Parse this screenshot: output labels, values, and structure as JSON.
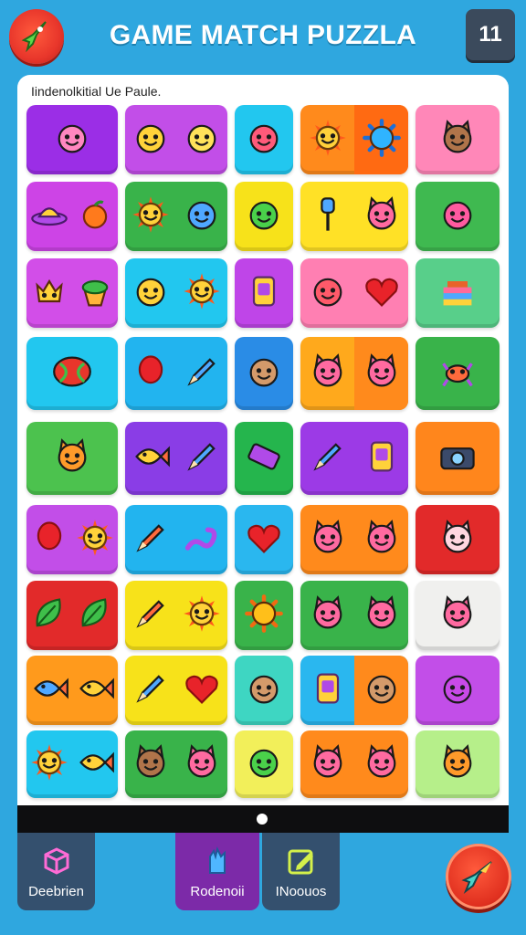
{
  "header": {
    "title": "GAME MATCH PUZZLA",
    "level": "11",
    "logo_icon": "rocket-icon"
  },
  "board": {
    "subtitle": "Iindenolkitial Ue Paule.",
    "rows": [
      [
        {
          "bg": [
            "#9b2ee6",
            "#9b2ee6"
          ],
          "icons": [
            "monster-face-icon"
          ]
        },
        {
          "bg": [
            "#c24ee8",
            "#c24ee8"
          ],
          "icons": [
            "star-creature-icon",
            "ghost-face-icon"
          ]
        },
        {
          "bg": [
            "#22c7ef",
            "#22c7ef"
          ],
          "icons": [
            "hat-face-icon"
          ]
        },
        {
          "bg": [
            "#ff8a1c",
            "#ff6a12"
          ],
          "icons": [
            "sun-face-icon",
            "gear-icon"
          ]
        },
        {
          "bg": [
            "#ff87b8",
            "#ff87b8"
          ],
          "icons": [
            "bear-face-icon"
          ]
        }
      ],
      [
        {
          "bg": [
            "#cd44e6",
            "#cd44e6"
          ],
          "icons": [
            "ufo-icon",
            "orange-icon"
          ]
        },
        {
          "bg": [
            "#39b34a",
            "#39b34a"
          ],
          "icons": [
            "sun-face-icon",
            "gear-face-icon"
          ]
        },
        {
          "bg": [
            "#f7e21a",
            "#f7e21a"
          ],
          "icons": [
            "alien-face-icon"
          ]
        },
        {
          "bg": [
            "#ffe126",
            "#ffe126"
          ],
          "icons": [
            "lollipop-icon",
            "cat-face-icon"
          ]
        },
        {
          "bg": [
            "#3fb950",
            "#3fb950"
          ],
          "icons": [
            "elephant-face-icon"
          ]
        }
      ],
      [
        {
          "bg": [
            "#d24ee8",
            "#d24ee8"
          ],
          "icons": [
            "crown-creature-icon",
            "cupcake-icon"
          ]
        },
        {
          "bg": [
            "#22c7ef",
            "#22c7ef"
          ],
          "icons": [
            "duck-face-icon",
            "sun-face-icon"
          ]
        },
        {
          "bg": [
            "#bf45e8",
            "#bf45e8"
          ],
          "icons": [
            "phone-icon"
          ]
        },
        {
          "bg": [
            "#ff7fb2",
            "#ff7fb2"
          ],
          "icons": [
            "crab-face-icon",
            "heart-icon"
          ]
        },
        {
          "bg": [
            "#58cf8a",
            "#58cf8a"
          ],
          "icons": [
            "cake-icon"
          ]
        }
      ],
      [
        {
          "bg": [
            "#22c7ef",
            "#22c7ef"
          ],
          "icons": [
            "yarn-ball-icon"
          ]
        },
        {
          "bg": [
            "#22b4ef",
            "#22b4ef"
          ],
          "icons": [
            "balloon-icon",
            "crayon-icon"
          ]
        },
        {
          "bg": [
            "#2a8ce6",
            "#2a8ce6"
          ],
          "icons": [
            "face-icon"
          ]
        },
        {
          "bg": [
            "#ffa91c",
            "#ff8a1c"
          ],
          "icons": [
            "cat-face-icon",
            "cat-face-icon"
          ]
        },
        {
          "bg": [
            "#39b34a",
            "#39b34a"
          ],
          "icons": [
            "crab-icon"
          ]
        }
      ],
      [
        {
          "bg": [
            "#4cc24e",
            "#4cc24e"
          ],
          "icons": [
            "fox-face-icon"
          ]
        },
        {
          "bg": [
            "#8a3de6",
            "#8a3de6"
          ],
          "icons": [
            "bird-icon",
            "crayon-icon"
          ]
        },
        {
          "bg": [
            "#25b54d",
            "#25b54d"
          ],
          "icons": [
            "candy-bar-icon"
          ]
        },
        {
          "bg": [
            "#9c3ae6",
            "#9c3ae6"
          ],
          "icons": [
            "crayon-icon",
            "phone-icon"
          ]
        },
        {
          "bg": [
            "#ff861c",
            "#ff861c"
          ],
          "icons": [
            "camera-icon"
          ]
        }
      ],
      [
        {
          "bg": [
            "#c24ee8",
            "#c24ee8"
          ],
          "icons": [
            "egg-icon",
            "sun-face-icon"
          ]
        },
        {
          "bg": [
            "#22b4ef",
            "#22b4ef"
          ],
          "icons": [
            "pencil-icon",
            "snake-icon"
          ]
        },
        {
          "bg": [
            "#2ab7ef",
            "#2ab7ef"
          ],
          "icons": [
            "heart-icon"
          ]
        },
        {
          "bg": [
            "#ff8a1c",
            "#ff8a1c"
          ],
          "icons": [
            "cat-face-icon",
            "cat-face-icon"
          ]
        },
        {
          "bg": [
            "#e22a2a",
            "#e22a2a"
          ],
          "icons": [
            "mouse-face-icon"
          ]
        }
      ],
      [
        {
          "bg": [
            "#e22a2a",
            "#e22a2a"
          ],
          "icons": [
            "leaf-icon",
            "leaf-icon"
          ]
        },
        {
          "bg": [
            "#f7e21a",
            "#f7e21a"
          ],
          "icons": [
            "pencil-icon",
            "sun-face-icon"
          ]
        },
        {
          "bg": [
            "#39b34a",
            "#39b34a"
          ],
          "icons": [
            "sun-icon"
          ]
        },
        {
          "bg": [
            "#39b34a",
            "#39b34a"
          ],
          "icons": [
            "cat-face-icon",
            "cat-face-icon"
          ]
        },
        {
          "bg": [
            "#f0f0ee",
            "#f0f0ee"
          ],
          "icons": [
            "cat-face-icon"
          ]
        }
      ],
      [
        {
          "bg": [
            "#ff9a1c",
            "#ff9a1c"
          ],
          "icons": [
            "fish-icon",
            "bird-icon"
          ]
        },
        {
          "bg": [
            "#f7e21a",
            "#f7e21a"
          ],
          "icons": [
            "crayon-icon",
            "heart-icon"
          ]
        },
        {
          "bg": [
            "#3ed6c2",
            "#3ed6c2"
          ],
          "icons": [
            "face-icon"
          ]
        },
        {
          "bg": [
            "#2ab7ef",
            "#ff8a1c"
          ],
          "icons": [
            "jar-icon",
            "face-icon"
          ]
        },
        {
          "bg": [
            "#c24ee8",
            "#c24ee8"
          ],
          "icons": [
            "robot-face-icon"
          ]
        }
      ],
      [
        {
          "bg": [
            "#22c7ef",
            "#22c7ef"
          ],
          "icons": [
            "sun-face-icon",
            "bird-icon"
          ]
        },
        {
          "bg": [
            "#39b34a",
            "#39b34a"
          ],
          "icons": [
            "bear-face-icon",
            "cat-face-icon"
          ]
        },
        {
          "bg": [
            "#f2ef5a",
            "#f2ef5a"
          ],
          "icons": [
            "alien-face-icon"
          ]
        },
        {
          "bg": [
            "#ff8a1c",
            "#ff8a1c"
          ],
          "icons": [
            "cat-face-icon",
            "cat-face-icon"
          ]
        },
        {
          "bg": [
            "#b6ef8a",
            "#b6ef8a"
          ],
          "icons": [
            "fox-face-icon"
          ]
        }
      ]
    ]
  },
  "toolbar": {
    "left_label": "Deebrien",
    "left_icon": "cube-icon",
    "center_label": "Rodenoii",
    "center_icon": "glove-icon",
    "right_label": "INoouos",
    "right_icon": "edit-icon",
    "fab_icon": "rocket-icon"
  },
  "colors": {
    "background": "#2fa7df",
    "board": "#ffffff",
    "bar": "#0e0e10"
  }
}
